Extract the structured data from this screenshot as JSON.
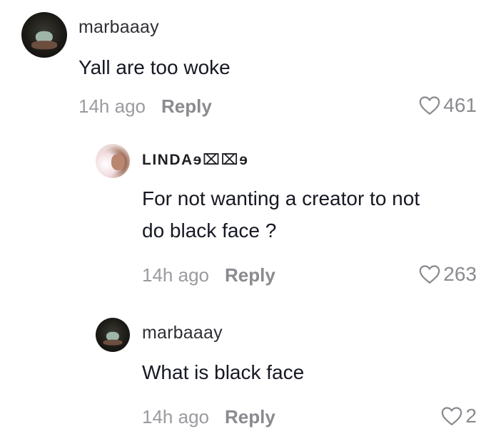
{
  "comments": [
    {
      "username": "marbaaay",
      "text_lines": [
        "Yall are too woke"
      ],
      "time": "14h ago",
      "reply_label": "Reply",
      "likes": "461"
    },
    {
      "username": "LINDAɘ⌧⌧ɘ",
      "text_lines": [
        "For not wanting a creator to not",
        "do black face ?"
      ],
      "time": "14h ago",
      "reply_label": "Reply",
      "likes": "263"
    },
    {
      "username": "marbaaay",
      "text_lines": [
        "What is black face"
      ],
      "time": "14h ago",
      "reply_label": "Reply",
      "likes": "2"
    }
  ],
  "icons": {
    "like": "heart-outline-icon"
  },
  "colors": {
    "text": "#161823",
    "muted": "#8a8a90"
  }
}
